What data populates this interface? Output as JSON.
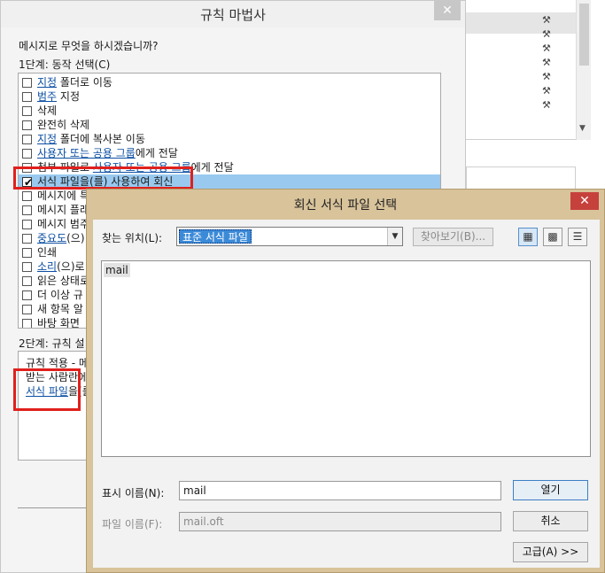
{
  "wizard": {
    "title": "규칙 마법사",
    "close_glyph": "✕",
    "question": "메시지로 무엇을 하시겠습니까?",
    "step1_label": "1단계: 동작 선택(C)",
    "actions": [
      {
        "parts": [
          {
            "t": "지정",
            "link": true
          },
          {
            "t": " 폴더로 이동"
          }
        ],
        "checked": false
      },
      {
        "parts": [
          {
            "t": "범주",
            "link": true
          },
          {
            "t": " 지정"
          }
        ],
        "checked": false
      },
      {
        "parts": [
          {
            "t": "삭제"
          }
        ],
        "checked": false
      },
      {
        "parts": [
          {
            "t": "완전히 삭제"
          }
        ],
        "checked": false
      },
      {
        "parts": [
          {
            "t": "지정",
            "link": true
          },
          {
            "t": " 폴더에 복사본 이동"
          }
        ],
        "checked": false
      },
      {
        "parts": [
          {
            "t": "사용자 또는 공용 그룹",
            "link": true
          },
          {
            "t": "에게 전달"
          }
        ],
        "checked": false
      },
      {
        "parts": [
          {
            "t": "첨부 파일로 "
          },
          {
            "t": "사용자 또는 공용 그룹",
            "link": true
          },
          {
            "t": "에게 전달"
          }
        ],
        "checked": false
      },
      {
        "parts": [
          {
            "t": "서식 파일을(를) 사용하여 회신"
          }
        ],
        "checked": true,
        "selected": true
      },
      {
        "parts": [
          {
            "t": "메시지에 특"
          }
        ],
        "checked": false
      },
      {
        "parts": [
          {
            "t": "메시지 플래"
          }
        ],
        "checked": false
      },
      {
        "parts": [
          {
            "t": "메시지 범주"
          }
        ],
        "checked": false
      },
      {
        "parts": [
          {
            "t": "중요도",
            "link": true
          },
          {
            "t": "(으)"
          }
        ],
        "checked": false
      },
      {
        "parts": [
          {
            "t": "인쇄"
          }
        ],
        "checked": false
      },
      {
        "parts": [
          {
            "t": "소리",
            "link": true
          },
          {
            "t": "(으)로"
          }
        ],
        "checked": false
      },
      {
        "parts": [
          {
            "t": "읽은 상태로"
          }
        ],
        "checked": false
      },
      {
        "parts": [
          {
            "t": "더 이상 규"
          }
        ],
        "checked": false
      },
      {
        "parts": [
          {
            "t": "새 항목 알"
          }
        ],
        "checked": false
      },
      {
        "parts": [
          {
            "t": "바탕 화면 "
          }
        ],
        "checked": false
      }
    ],
    "step2_label": "2단계: 규칙 설",
    "desc_line1": "규칙 적용 - 메",
    "desc_line2": "받는 사람란에",
    "desc_line3_link": "서식 파일",
    "desc_line3_rest": "을(를"
  },
  "dialog": {
    "title": "회신 서식 파일 선택",
    "close_glyph": "✕",
    "lookin_label": "찾는 위치(L):",
    "lookin_value": "표준 서식 파일",
    "dropdown_glyph": "▼",
    "browse_label": "찾아보기(B)...",
    "view_icons": [
      "▦",
      "▩",
      "☰"
    ],
    "files": [
      "mail"
    ],
    "display_name_label": "표시 이름(N):",
    "display_name_value": "mail",
    "file_name_label": "파일 이름(F):",
    "file_name_value": "mail.oft",
    "open_label": "열기",
    "cancel_label": "취소",
    "advanced_label": "고급(A) >>"
  },
  "background_window": {
    "row_icon": "⚒",
    "scroll_down_glyph": "▼"
  },
  "colors": {
    "selection": "#99c9ef",
    "link": "#0b4ea2",
    "highlight_red": "#e0201c",
    "dialog_frame": "#d8c39a",
    "close_red": "#c6413c"
  }
}
